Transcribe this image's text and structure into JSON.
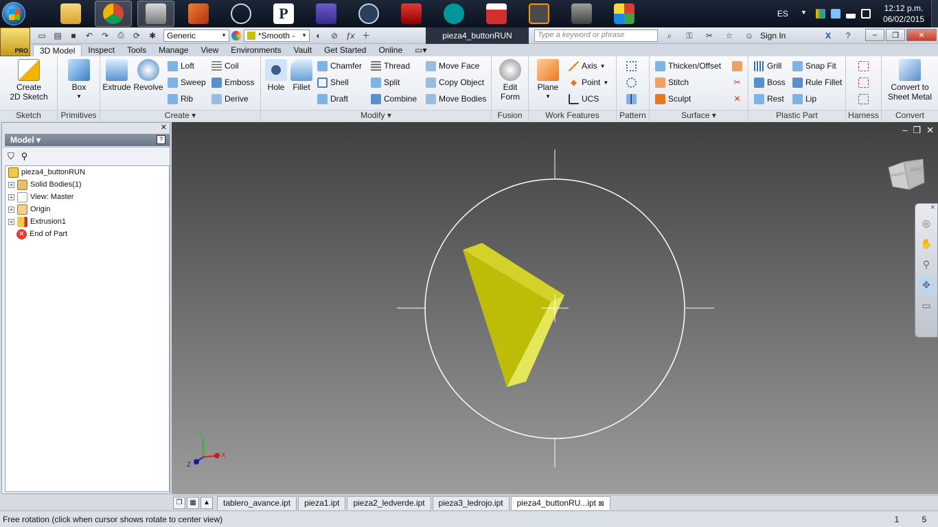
{
  "taskbar": {
    "apps": [
      "Windows Explorer",
      "Google Chrome",
      "Autodesk Inventor Professional",
      "MATLAB",
      "Atom",
      "Pixlr",
      "Equalizer",
      "Steam",
      "AutoCAD",
      "Arduino",
      "MPLAB IDE",
      "Sublime Text",
      "Rhino",
      "Control Panel"
    ],
    "language": "ES",
    "time": "12:12 p.m.",
    "date": "06/02/2015"
  },
  "qat": {
    "material": "Generic",
    "appearance": "*Smooth -",
    "doc_title": "pieza4_buttonRUN",
    "search_placeholder": "Type a keyword or phrase",
    "sign_in": "Sign In",
    "badge": "PRO"
  },
  "tabs": [
    "3D Model",
    "Inspect",
    "Tools",
    "Manage",
    "View",
    "Environments",
    "Vault",
    "Get Started",
    "Online"
  ],
  "ribbon": {
    "sketch": {
      "label": "Sketch",
      "create_sketch": "Create\n2D Sketch"
    },
    "primitives": {
      "label": "Primitives",
      "box": "Box"
    },
    "create": {
      "label": "Create",
      "extrude": "Extrude",
      "revolve": "Revolve",
      "loft": "Loft",
      "coil": "Coil",
      "sweep": "Sweep",
      "emboss": "Emboss",
      "rib": "Rib",
      "derive": "Derive"
    },
    "modify": {
      "label": "Modify",
      "hole": "Hole",
      "fillet": "Fillet",
      "chamfer": "Chamfer",
      "thread": "Thread",
      "move_face": "Move Face",
      "shell": "Shell",
      "split": "Split",
      "copy_object": "Copy Object",
      "draft": "Draft",
      "combine": "Combine",
      "move_bodies": "Move Bodies"
    },
    "fusion": {
      "label": "Fusion",
      "edit_form": "Edit\nForm"
    },
    "work_features": {
      "label": "Work Features",
      "plane": "Plane",
      "axis": "Axis",
      "point": "Point",
      "ucs": "UCS"
    },
    "pattern": {
      "label": "Pattern"
    },
    "surface": {
      "label": "Surface",
      "thicken": "Thicken/Offset",
      "stitch": "Stitch",
      "sculpt": "Sculpt"
    },
    "plastic": {
      "label": "Plastic Part",
      "grill": "Grill",
      "snap_fit": "Snap Fit",
      "boss": "Boss",
      "rule_fillet": "Rule Fillet",
      "rest": "Rest",
      "lip": "Lip"
    },
    "harness": {
      "label": "Harness"
    },
    "convert": {
      "label": "Convert",
      "to_sheet_metal": "Convert to\nSheet Metal"
    }
  },
  "browser": {
    "title": "Model",
    "nodes": [
      "pieza4_buttonRUN",
      "Solid Bodies(1)",
      "View: Master",
      "Origin",
      "Extrusion1",
      "End of Part"
    ]
  },
  "viewport": {
    "viewcube_faces": [
      "FRONT",
      "RIGHT"
    ],
    "triad": {
      "x": "X",
      "y": "Y",
      "z": "Z"
    }
  },
  "doc_tabs": [
    "tablero_avance.ipt",
    "pieza1.ipt",
    "pieza2_ledverde.ipt",
    "pieza3_ledrojo.ipt",
    "pieza4_buttonRU...ipt"
  ],
  "status": {
    "text": "Free rotation (click when cursor shows rotate to center view)",
    "n1": "1",
    "n2": "5"
  }
}
